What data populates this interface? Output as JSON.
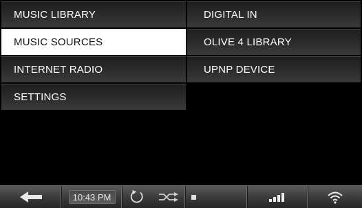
{
  "menu_left": [
    {
      "label": "MUSIC LIBRARY",
      "selected": false
    },
    {
      "label": "MUSIC SOURCES",
      "selected": true
    },
    {
      "label": "INTERNET RADIO",
      "selected": false
    },
    {
      "label": "SETTINGS",
      "selected": false
    }
  ],
  "menu_right": [
    {
      "label": "DIGITAL IN"
    },
    {
      "label": "OLIVE 4 LIBRARY"
    },
    {
      "label": "UPNP DEVICE"
    }
  ],
  "bottom_bar": {
    "time": "10:43 PM",
    "icons": {
      "back": "back-arrow-icon",
      "repeat": "repeat-icon",
      "shuffle": "shuffle-icon",
      "stop": "stop-icon",
      "signal": "signal-strength-icon",
      "wifi": "wifi-icon"
    }
  },
  "colors": {
    "background": "#000000",
    "menu_text": "#ffffff",
    "selected_bg": "#ffffff",
    "selected_text": "#111111"
  }
}
